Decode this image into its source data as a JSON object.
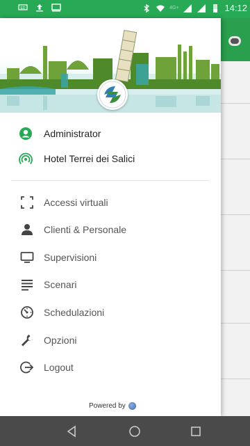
{
  "status_bar": {
    "time": "14:12",
    "network": "4G+",
    "colors": {
      "background": "#27a956"
    }
  },
  "drawer": {
    "user": {
      "name": "Administrator",
      "icon": "account-circle-icon"
    },
    "hotel": {
      "name": "Hotel Terrei dei Salici",
      "icon": "wifi-tethering-icon"
    },
    "menu": [
      {
        "label": "Accessi virtuali",
        "icon": "scan-frame-icon"
      },
      {
        "label": "Clienti & Personale",
        "icon": "person-icon"
      },
      {
        "label": "Supervisioni",
        "icon": "monitor-icon"
      },
      {
        "label": "Scenari",
        "icon": "notes-icon"
      },
      {
        "label": "Schedulazioni",
        "icon": "timer-icon"
      },
      {
        "label": "Opzioni",
        "icon": "wrench-icon"
      },
      {
        "label": "Logout",
        "icon": "logout-icon"
      }
    ],
    "footer": {
      "powered_by": "Powered by"
    }
  },
  "colors": {
    "accent": "#27a956",
    "brand_logo": "#3a8e3d",
    "icon_active": "#27a956",
    "menu_text": "#555555"
  }
}
